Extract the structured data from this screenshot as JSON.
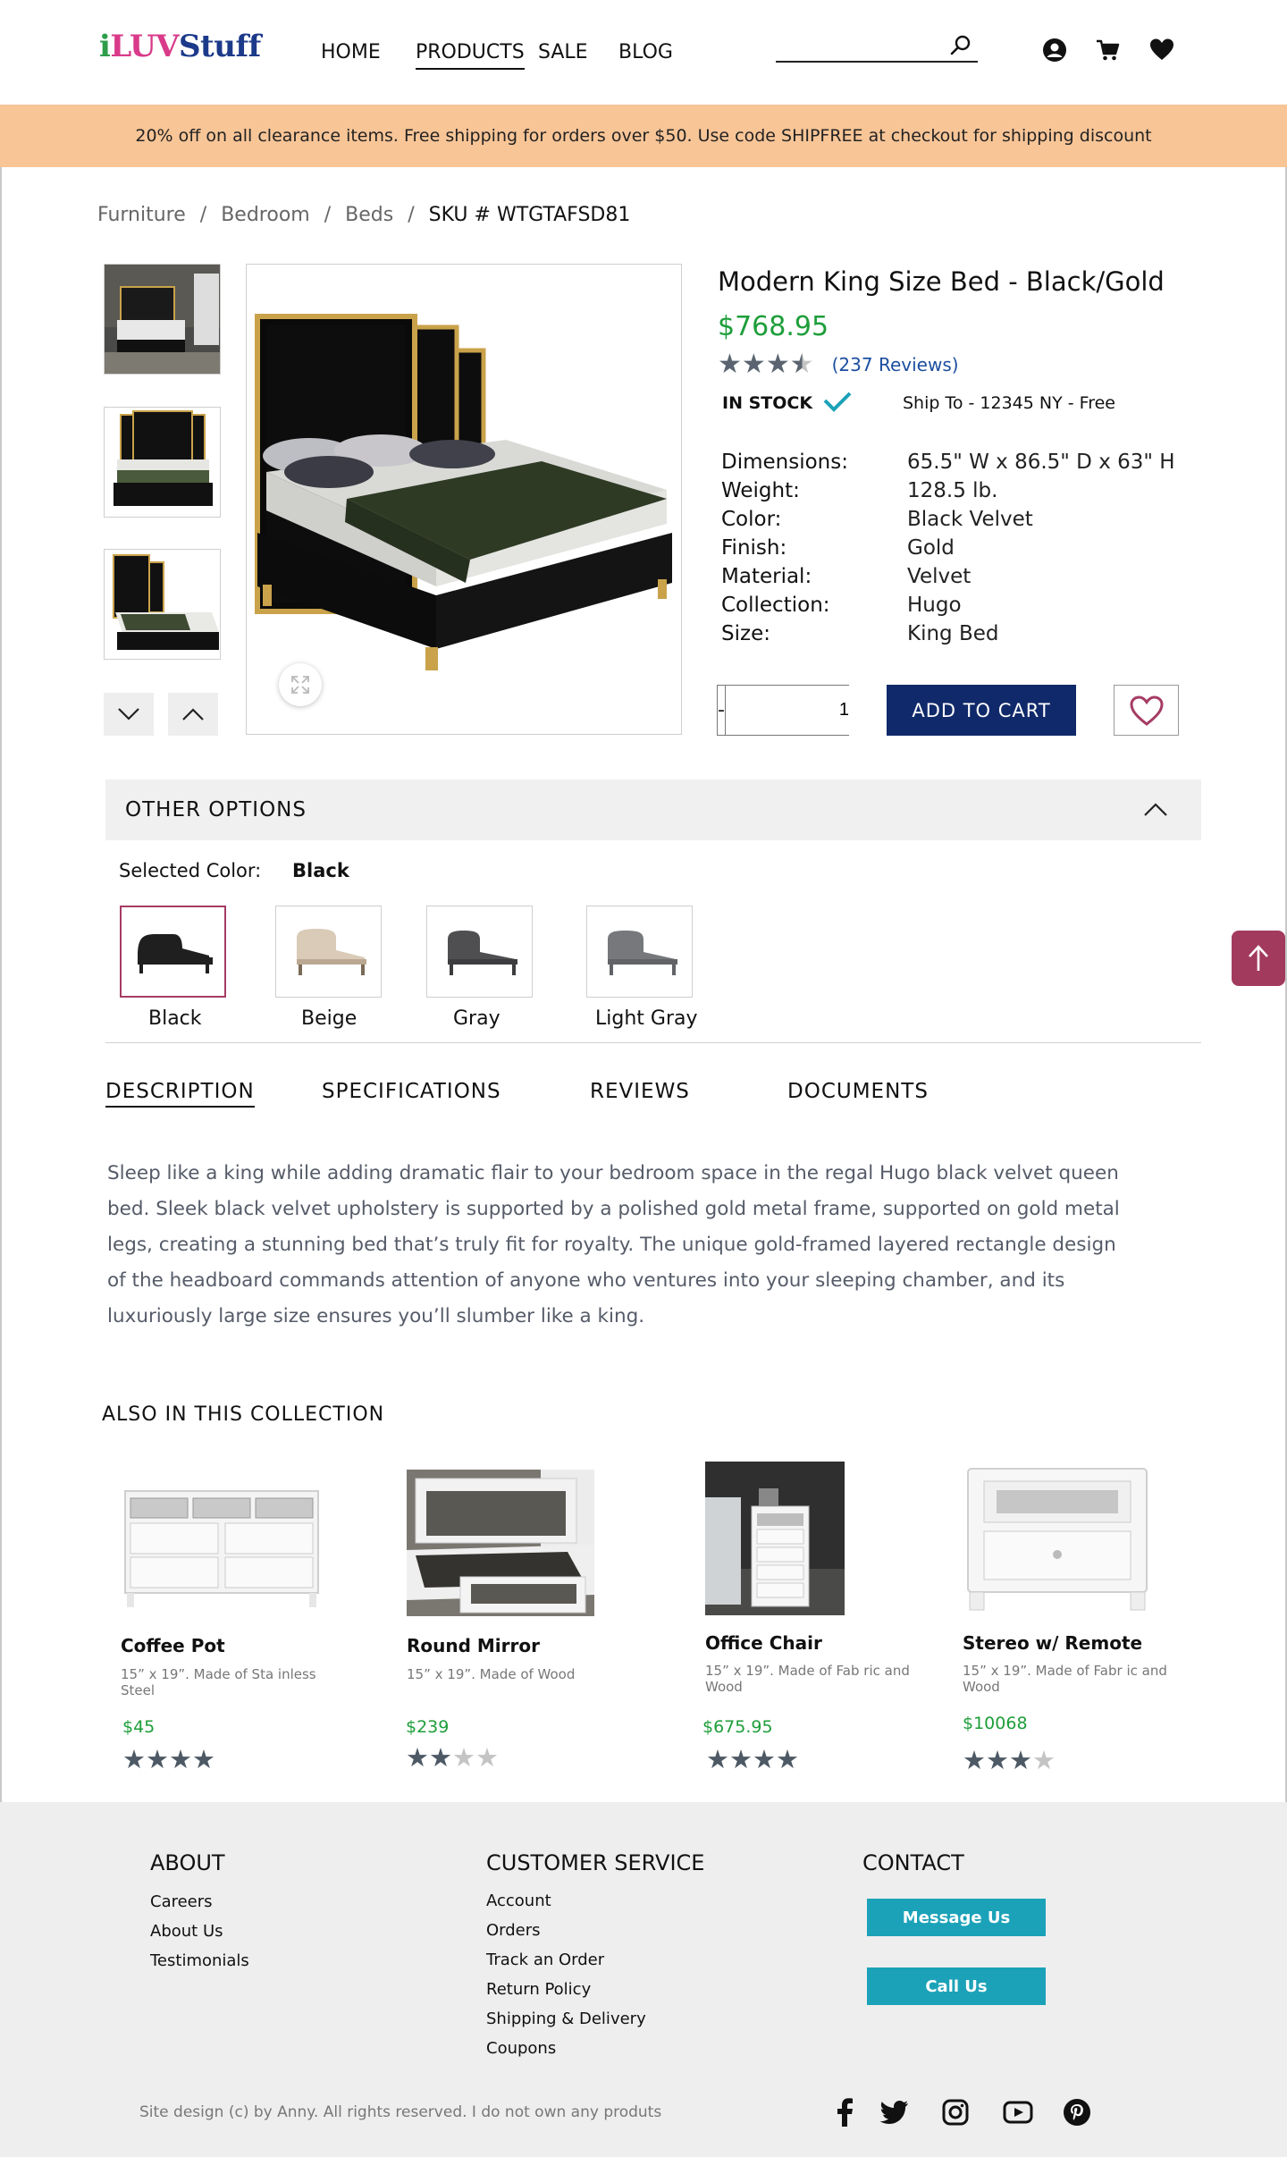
{
  "brand": {
    "logo_part1": "i",
    "logo_part2": "LUV",
    "logo_part3": "Stuff"
  },
  "nav": {
    "items": [
      "HOME",
      "PRODUCTS",
      "SALE",
      "BLOG"
    ],
    "active": "PRODUCTS"
  },
  "search": {
    "placeholder": ""
  },
  "header_icons": [
    "account-icon",
    "cart-icon",
    "wishlist-heart-icon"
  ],
  "promo_banner": "20% off on all clearance items. Free shipping for orders over $50. Use code SHIPFREE at checkout for shipping discount",
  "breadcrumb": {
    "items": [
      "Furniture",
      "Bedroom",
      "Beds"
    ],
    "sku": "SKU # WTGTAFSD81",
    "separator": "/"
  },
  "product": {
    "title": "Modern King Size Bed - Black/Gold",
    "price": "$768.95",
    "rating": 3.5,
    "reviews_text": "(237 Reviews)",
    "stock": "IN STOCK",
    "ship_to": "Ship To - 12345 NY - Free",
    "specs": [
      {
        "label": "Dimensions:",
        "value": "65.5\" W x 86.5\" D x 63\" H"
      },
      {
        "label": "Weight:",
        "value": "128.5 lb."
      },
      {
        "label": "Color:",
        "value": "Black Velvet"
      },
      {
        "label": "Finish:",
        "value": "Gold"
      },
      {
        "label": "Material:",
        "value": "Velvet"
      },
      {
        "label": "Collection:",
        "value": "Hugo"
      },
      {
        "label": "Size:",
        "value": "King Bed"
      }
    ],
    "quantity": "1",
    "qty_minus": "-",
    "qty_plus": "+",
    "add_to_cart": "ADD TO CART"
  },
  "other_options": {
    "title": "OTHER OPTIONS",
    "selected_label": "Selected Color:",
    "selected_value": "Black",
    "colors": [
      {
        "name": "Black",
        "frame": "#1f1f1f",
        "mattress": "#ececec"
      },
      {
        "name": "Beige",
        "frame": "#d9cbb8",
        "mattress": "#f2f2f2"
      },
      {
        "name": "Gray",
        "frame": "#4f4f52",
        "mattress": "#eaeaea"
      },
      {
        "name": "Light Gray",
        "frame": "#76787c",
        "mattress": "#eaeaea"
      }
    ]
  },
  "tabs": [
    "DESCRIPTION",
    "SPECIFICATIONS",
    "REVIEWS",
    "DOCUMENTS"
  ],
  "active_tab": "DESCRIPTION",
  "description": "Sleep like a king while adding dramatic flair to your bedroom space in the regal Hugo black velvet queen bed. Sleek black velvet upholstery is supported by a polished gold metal frame, supported on gold metal legs, creating a stunning bed that’s truly fit for royalty. The unique gold-framed layered rectangle design of the headboard commands attention of anyone who ventures into your sleeping chamber, and its luxuriously large size ensures you’ll slumber like a king.",
  "collection": {
    "title": "ALSO IN THIS COLLECTION",
    "items": [
      {
        "name": "Coffee Pot",
        "desc": "15” x 19”. Made of Sta inless Steel",
        "price": "$45",
        "rating": 4
      },
      {
        "name": "Round Mirror",
        "desc": "15” x 19”. Made of Wood",
        "price": "$239",
        "rating": 2
      },
      {
        "name": "Office Chair",
        "desc": "15” x 19”. Made of Fab ric and Wood",
        "price": "$675.95",
        "rating": 4
      },
      {
        "name": "Stereo w/ Remote",
        "desc": "15” x 19”. Made of Fabr ic and Wood",
        "price": "$10068",
        "rating": 3
      }
    ]
  },
  "footer": {
    "about": {
      "title": "ABOUT",
      "links": [
        "Careers",
        "About Us",
        "Testimonials"
      ]
    },
    "service": {
      "title": "CUSTOMER SERVICE",
      "links": [
        "Account",
        "Orders",
        "Track an Order",
        "Return Policy",
        "Shipping & Delivery",
        "Coupons"
      ]
    },
    "contact": {
      "title": "CONTACT",
      "message_btn": "Message Us",
      "call_btn": "Call Us"
    },
    "copyright": "Site design (c) by Anny. All rights reserved. I do not own any produts",
    "social": [
      "facebook-icon",
      "twitter-icon",
      "instagram-icon",
      "youtube-icon",
      "pinterest-icon"
    ]
  },
  "colors": {
    "accent_navy": "#10296a",
    "price_green": "#1e9e3a",
    "promo_bg": "#f8c597",
    "contact_btn": "#1ba2b8",
    "scroll_top": "#a23a5e"
  }
}
